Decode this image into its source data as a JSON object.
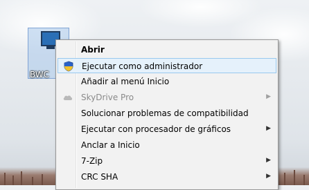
{
  "desktop": {
    "icon_label": "BWC"
  },
  "context_menu": {
    "items": [
      {
        "label": "Abrir",
        "bold": true
      },
      {
        "label": "Ejecutar como administrador",
        "icon": "uac-shield-icon",
        "highlighted": true
      },
      {
        "label": "Añadir al menú Inicio"
      },
      {
        "label": "SkyDrive Pro",
        "icon": "skydrive-cloud-icon",
        "disabled": true,
        "submenu": true
      },
      {
        "label": "Solucionar problemas de compatibilidad"
      },
      {
        "label": "Ejecutar con procesador de gráficos",
        "submenu": true
      },
      {
        "label": "Anclar a Inicio"
      },
      {
        "label": "7-Zip",
        "submenu": true
      },
      {
        "label": "CRC SHA",
        "submenu": true
      }
    ],
    "submenu_arrow": "▶"
  },
  "colors": {
    "highlight_bg": "#e5f1fb",
    "highlight_border": "#99c9ef",
    "menu_bg": "#f2f2f2",
    "shield_blue": "#2a62c9",
    "shield_yellow": "#f2c22e"
  }
}
